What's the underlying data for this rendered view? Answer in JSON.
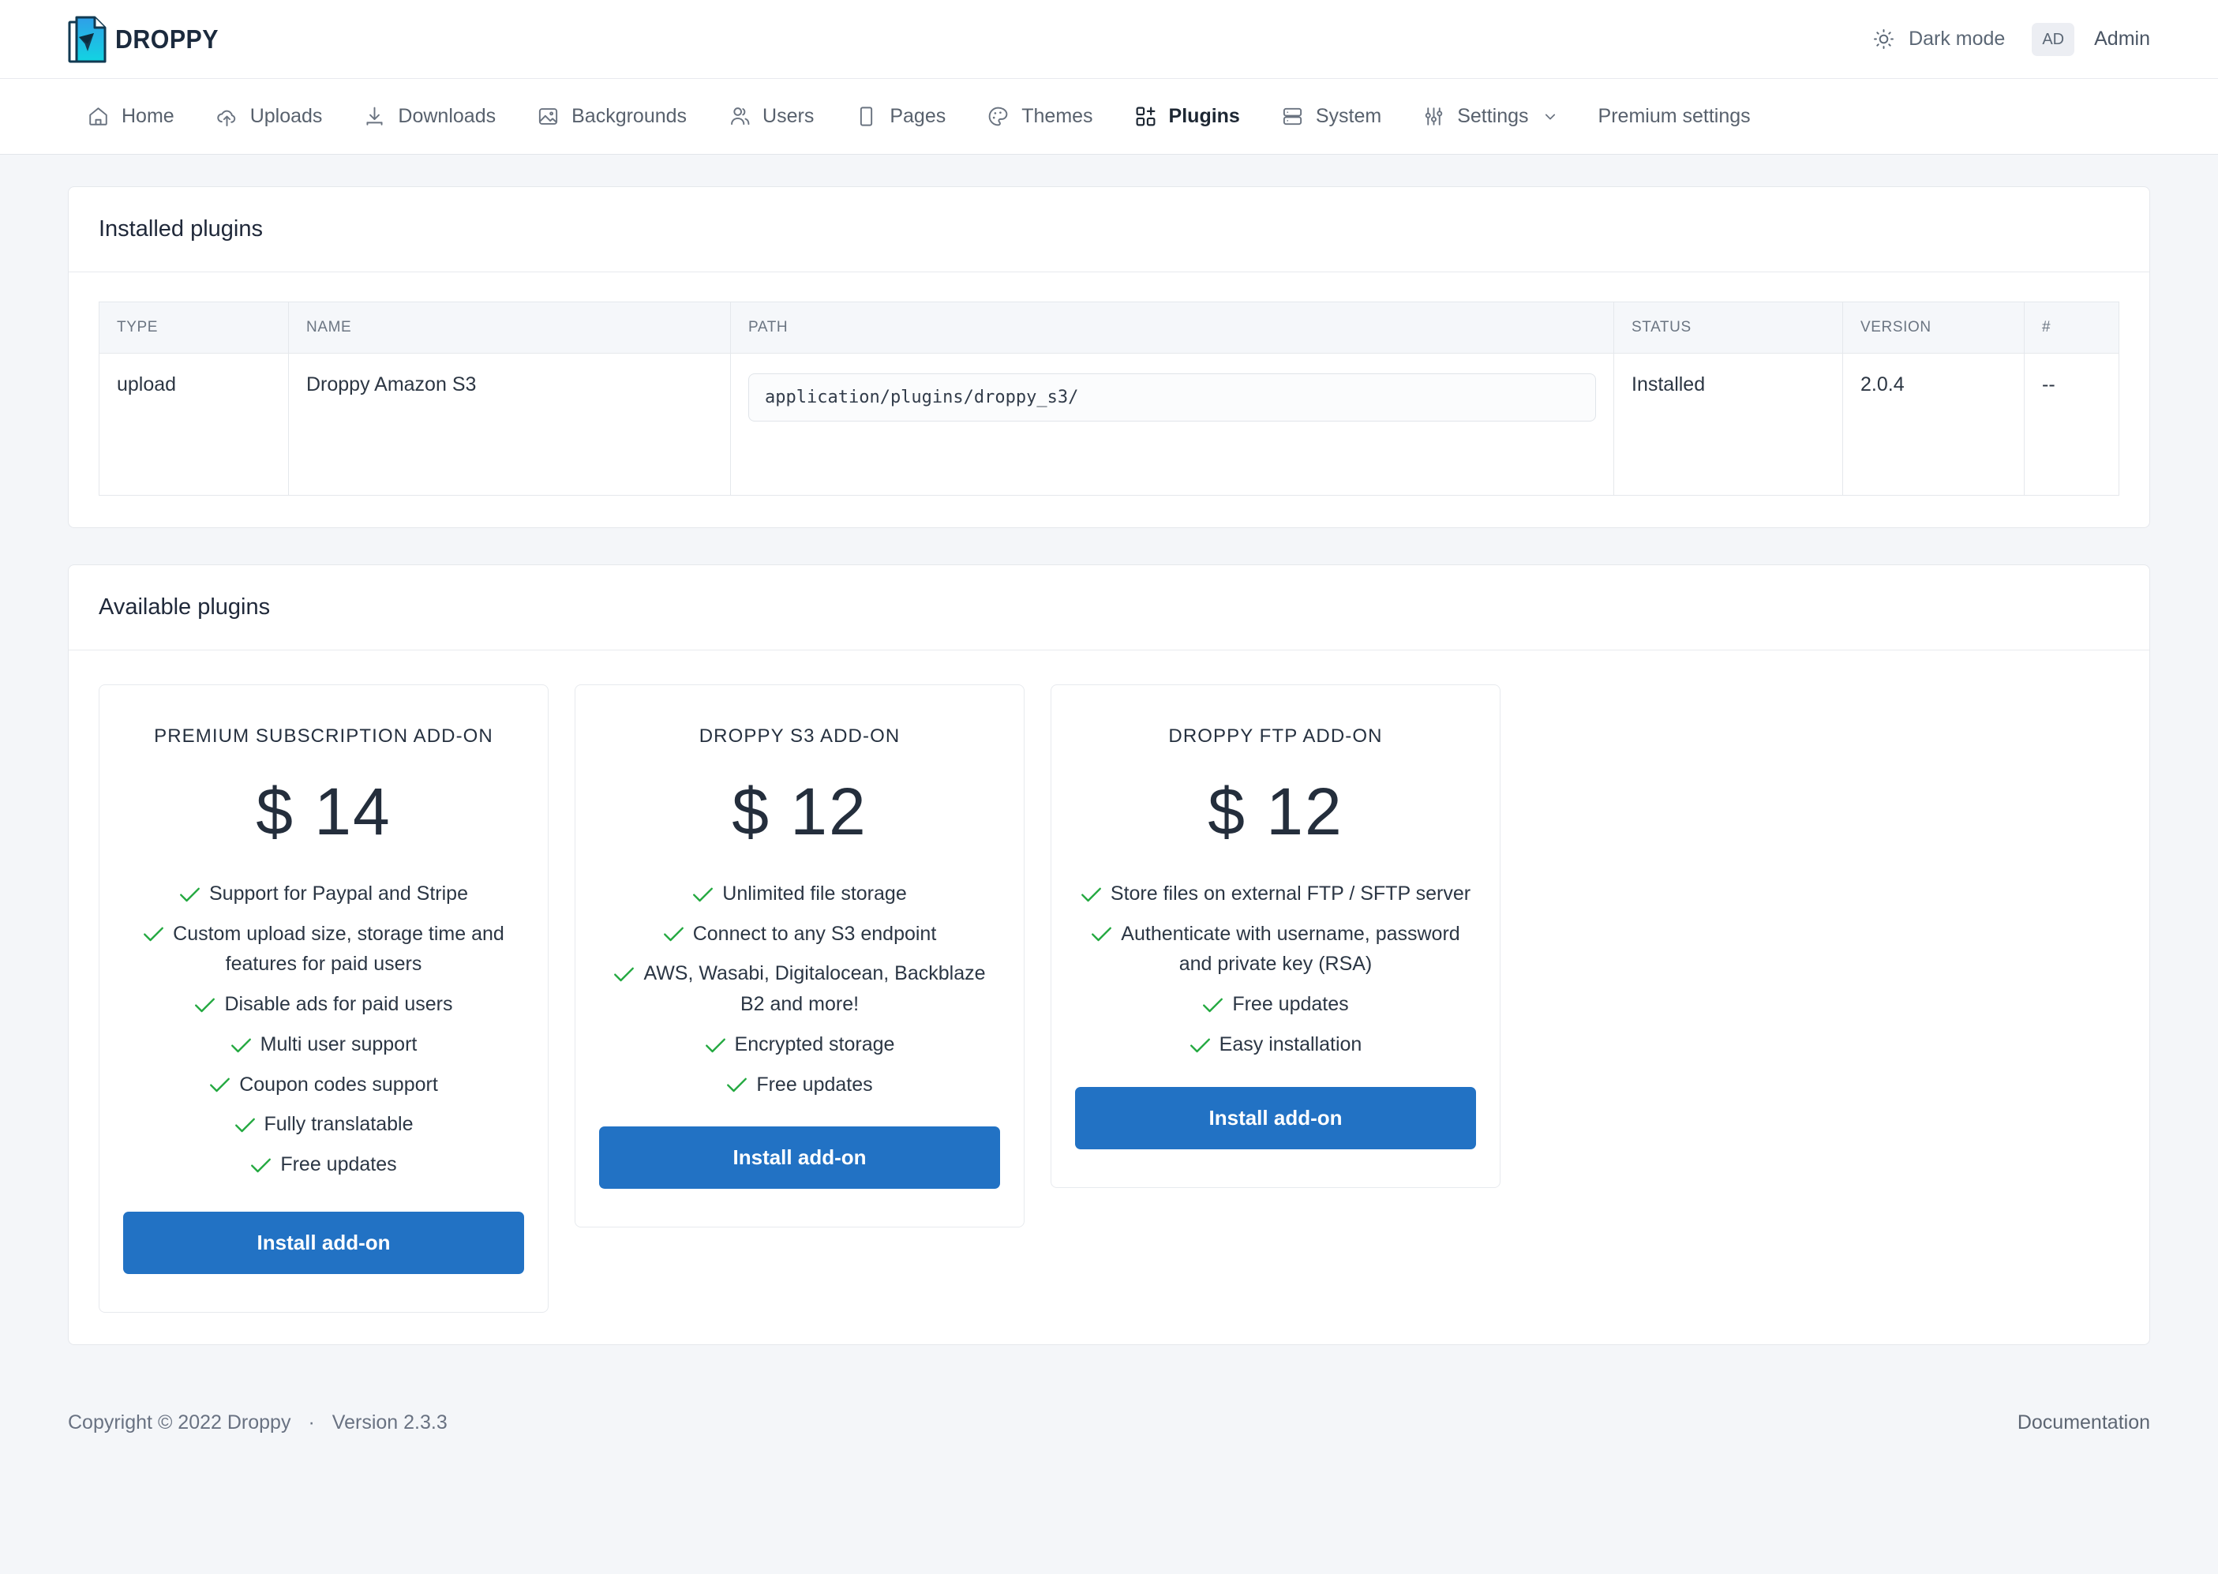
{
  "brand": {
    "name": "DROPPY"
  },
  "topbar": {
    "dark_mode_label": "Dark mode",
    "avatar_initials": "AD",
    "user_name": "Admin"
  },
  "nav": {
    "items": [
      {
        "label": "Home",
        "icon": "home-icon",
        "active": false
      },
      {
        "label": "Uploads",
        "icon": "cloud-upload-icon",
        "active": false
      },
      {
        "label": "Downloads",
        "icon": "download-icon",
        "active": false
      },
      {
        "label": "Backgrounds",
        "icon": "image-icon",
        "active": false
      },
      {
        "label": "Users",
        "icon": "users-icon",
        "active": false
      },
      {
        "label": "Pages",
        "icon": "page-icon",
        "active": false
      },
      {
        "label": "Themes",
        "icon": "palette-icon",
        "active": false
      },
      {
        "label": "Plugins",
        "icon": "grid-plus-icon",
        "active": true
      },
      {
        "label": "System",
        "icon": "server-icon",
        "active": false
      },
      {
        "label": "Settings",
        "icon": "sliders-icon",
        "active": false
      },
      {
        "label": "Premium settings",
        "icon": "",
        "active": false
      }
    ]
  },
  "installed": {
    "title": "Installed plugins",
    "columns": [
      "TYPE",
      "NAME",
      "PATH",
      "STATUS",
      "VERSION",
      "#"
    ],
    "rows": [
      {
        "type": "upload",
        "name": "Droppy Amazon S3",
        "path": "application/plugins/droppy_s3/",
        "status": "Installed",
        "version": "2.0.4",
        "hash": "--"
      }
    ]
  },
  "available": {
    "title": "Available plugins",
    "cards": [
      {
        "title": "Premium Subscription Add-on",
        "price": "$ 14",
        "features": [
          "Support for Paypal and Stripe",
          "Custom upload size, storage time and features for paid users",
          "Disable ads for paid users",
          "Multi user support",
          "Coupon codes support",
          "Fully translatable",
          "Free updates"
        ],
        "button": "Install add-on"
      },
      {
        "title": "Droppy S3 Add-on",
        "price": "$ 12",
        "features": [
          "Unlimited file storage",
          "Connect to any S3 endpoint",
          "AWS, Wasabi, Digitalocean, Backblaze B2 and more!",
          "Encrypted storage",
          "Free updates"
        ],
        "button": "Install add-on"
      },
      {
        "title": "Droppy FTP Add-on",
        "price": "$ 12",
        "features": [
          "Store files on external FTP / SFTP server",
          "Authenticate with username, password and private key (RSA)",
          "Free updates",
          "Easy installation"
        ],
        "button": "Install add-on"
      }
    ]
  },
  "footer": {
    "copyright": "Copyright © 2022 Droppy",
    "separator": "·",
    "version": "Version 2.3.3",
    "documentation": "Documentation"
  },
  "colors": {
    "accent": "#2272c4",
    "check": "#22a83f",
    "text_dark": "#242e3c",
    "text_muted": "#6b7582",
    "page_bg": "#f4f6f9"
  }
}
